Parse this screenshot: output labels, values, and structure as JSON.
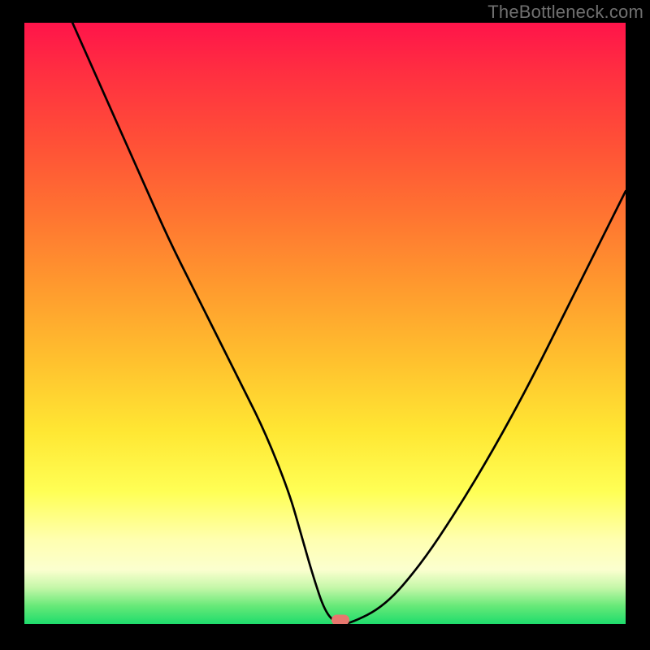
{
  "watermark": "TheBottleneck.com",
  "colors": {
    "frame": "#000000",
    "curve": "#000000",
    "marker": "#e7776e",
    "watermark": "#707070"
  },
  "chart_data": {
    "type": "line",
    "title": "",
    "xlabel": "",
    "ylabel": "",
    "xlim": [
      0,
      100
    ],
    "ylim": [
      0,
      100
    ],
    "grid": false,
    "legend": false,
    "series": [
      {
        "name": "bottleneck-curve",
        "x": [
          8,
          12,
          16,
          20,
          24,
          28,
          32,
          36,
          40,
          44,
          46,
          48,
          50,
          52,
          54,
          60,
          66,
          72,
          78,
          84,
          90,
          96,
          100
        ],
        "y": [
          100,
          91,
          82,
          73,
          64,
          56,
          48,
          40,
          32,
          22,
          15,
          8,
          2,
          0,
          0,
          3,
          10,
          19,
          29,
          40,
          52,
          64,
          72
        ]
      }
    ],
    "marker": {
      "x": 52.5,
      "y": 0.7
    }
  }
}
